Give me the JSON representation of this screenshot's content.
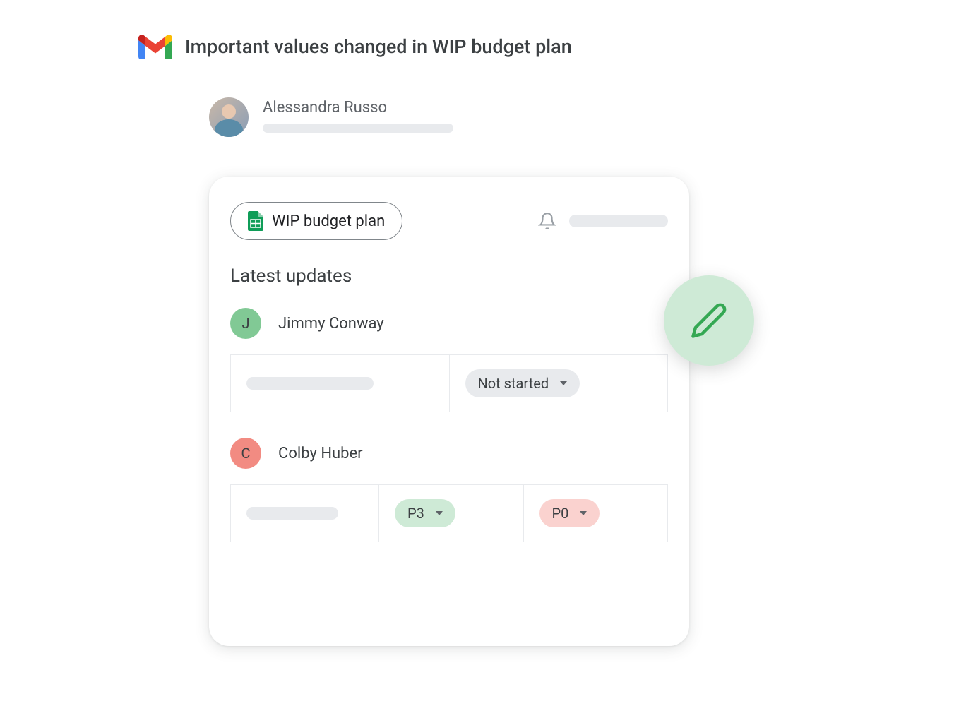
{
  "email": {
    "subject": "Important values changed in WIP budget plan",
    "sender_name": "Alessandra Russo"
  },
  "card": {
    "file_name": "WIP budget plan",
    "section_title": "Latest updates",
    "updates": [
      {
        "avatar_letter": "J",
        "name": "Jimmy Conway",
        "status": "Not started"
      },
      {
        "avatar_letter": "C",
        "name": "Colby Huber",
        "priority_from": "P3",
        "priority_to": "P0"
      }
    ]
  }
}
